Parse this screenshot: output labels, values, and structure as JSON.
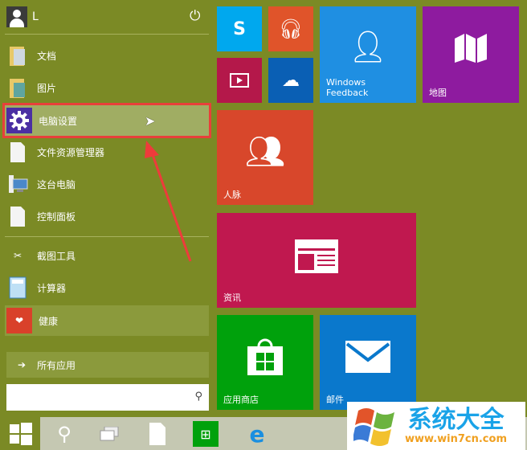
{
  "user": {
    "name": "L"
  },
  "menu_items": [
    {
      "label": "文档",
      "icon": "documents-folder-icon"
    },
    {
      "label": "图片",
      "icon": "pictures-folder-icon"
    },
    {
      "label": "电脑设置",
      "icon": "gear-icon"
    },
    {
      "label": "文件资源管理器",
      "icon": "file-icon"
    },
    {
      "label": "这台电脑",
      "icon": "computer-icon"
    },
    {
      "label": "控制面板",
      "icon": "file-icon"
    },
    {
      "label": "截图工具",
      "icon": "scissors-icon"
    },
    {
      "label": "计算器",
      "icon": "calculator-icon"
    },
    {
      "label": "健康",
      "icon": "heart-icon"
    }
  ],
  "all_apps": "所有应用",
  "search": {
    "placeholder": ""
  },
  "tiles": {
    "feedback": "Windows Feedback",
    "map": "地图",
    "people": "人脉",
    "news": "资讯",
    "store": "应用商店",
    "mail": "邮件"
  },
  "watermark": {
    "title": "系统大全",
    "url": "www.win7cn.com"
  },
  "colors": {
    "background": "#7b8a25",
    "highlight": "#e8403a"
  }
}
